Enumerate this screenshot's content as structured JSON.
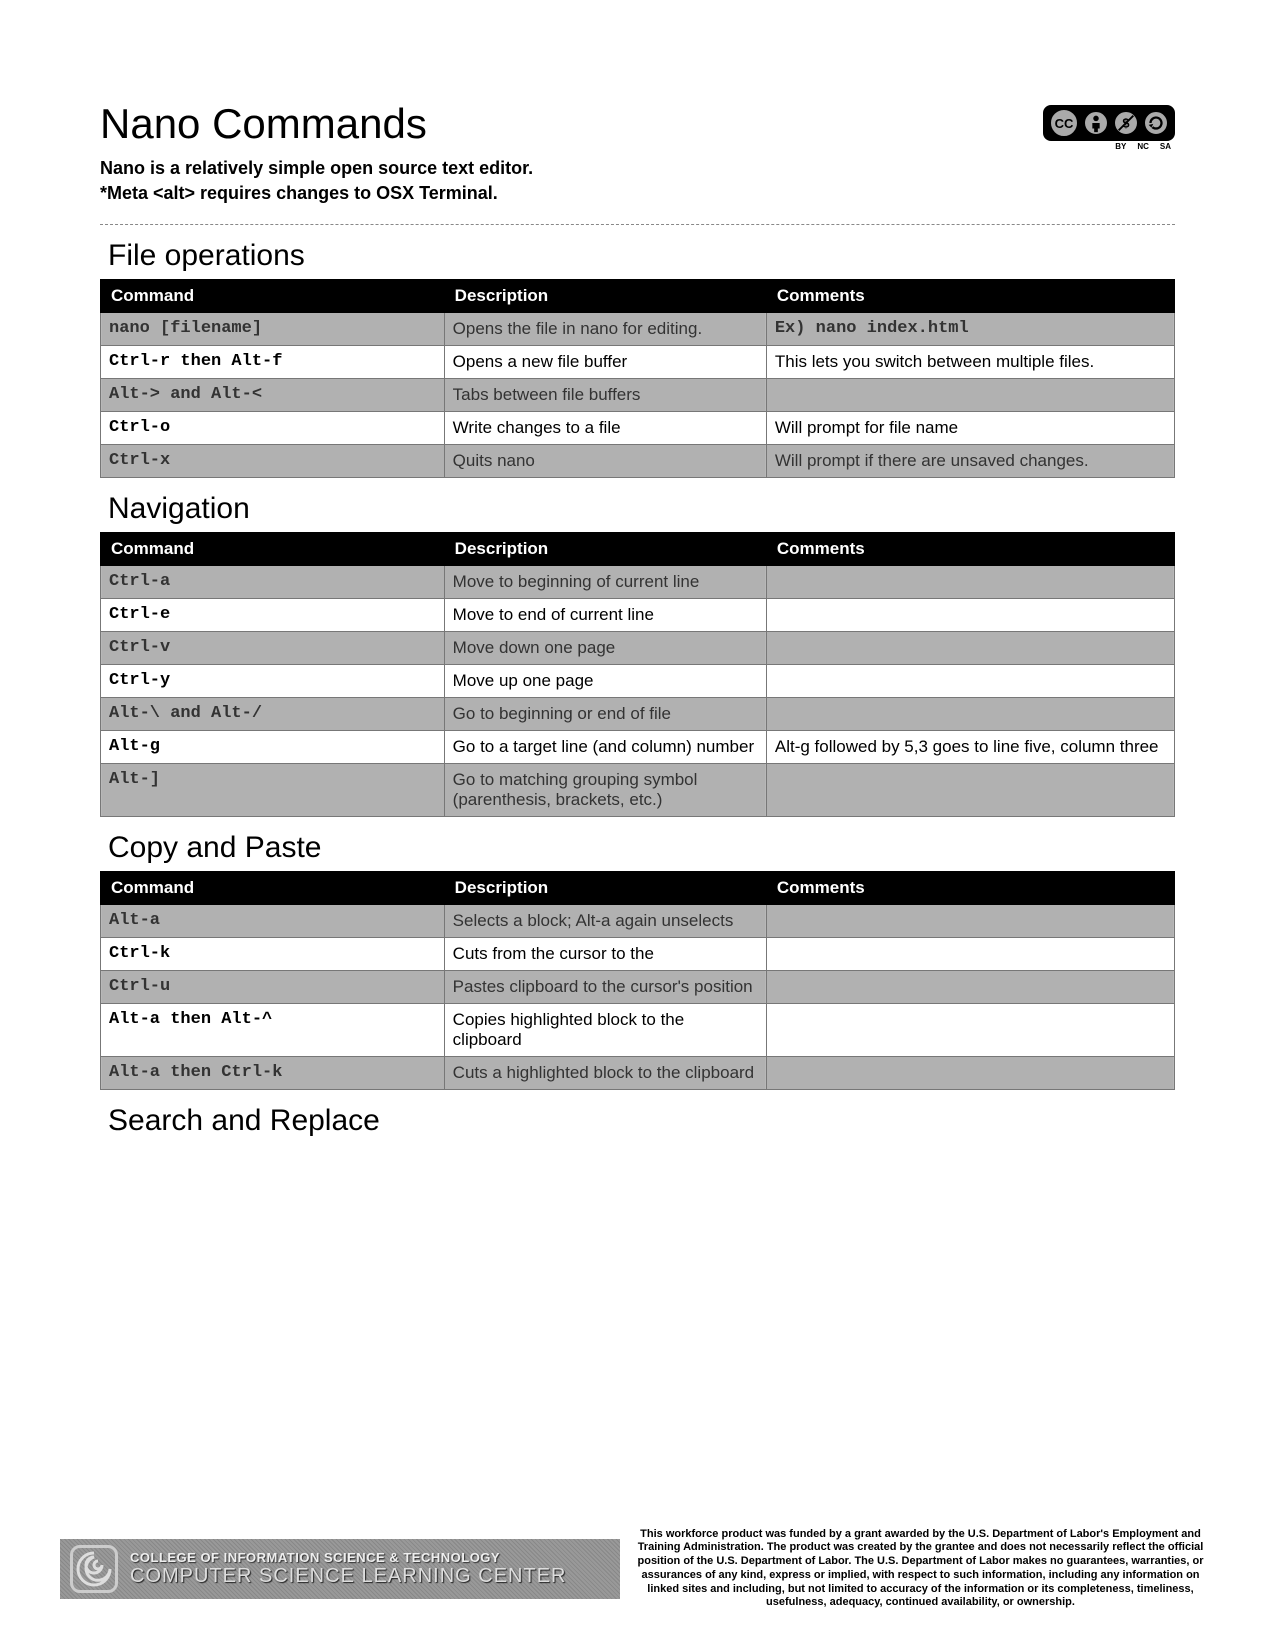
{
  "title": "Nano Commands",
  "subtitle_line1": "Nano is a relatively simple open source text editor.",
  "subtitle_line2": "*Meta <alt> requires changes to OSX Terminal.",
  "cc": {
    "labels": [
      "BY",
      "NC",
      "SA"
    ]
  },
  "headers": {
    "command": "Command",
    "description": "Description",
    "comments": "Comments"
  },
  "sections": [
    {
      "title": "File operations",
      "rows": [
        {
          "cmd": "nano [filename]",
          "desc": "Opens the file in nano for editing.",
          "comm": "Ex) nano index.html",
          "comm_mono": true
        },
        {
          "cmd": "Ctrl-r then Alt-f",
          "desc": "Opens a new file buffer",
          "comm": "This lets you switch between multiple files."
        },
        {
          "cmd": "Alt-> and Alt-<",
          "desc": "Tabs between file buffers",
          "comm": ""
        },
        {
          "cmd": "Ctrl-o",
          "desc": "Write changes to a file",
          "comm": "Will prompt for file name"
        },
        {
          "cmd": "Ctrl-x",
          "desc": "Quits nano",
          "comm": "Will prompt if there are unsaved changes."
        }
      ]
    },
    {
      "title": "Navigation",
      "rows": [
        {
          "cmd": "Ctrl-a",
          "desc": "Move to beginning of current line",
          "comm": ""
        },
        {
          "cmd": "Ctrl-e",
          "desc": "Move to end of current line",
          "comm": ""
        },
        {
          "cmd": "Ctrl-v",
          "desc": "Move down one page",
          "comm": ""
        },
        {
          "cmd": "Ctrl-y",
          "desc": "Move up one page",
          "comm": ""
        },
        {
          "cmd": "Alt-\\ and Alt-/",
          "desc": "Go to beginning  or end of file",
          "comm": ""
        },
        {
          "cmd": "Alt-g",
          "desc": "Go to a target line (and column) number",
          "comm": "Alt-g followed by 5,3 goes to line five, column three"
        },
        {
          "cmd": "Alt-]",
          "desc": "Go to matching grouping symbol (parenthesis, brackets, etc.)",
          "comm": ""
        }
      ]
    },
    {
      "title": "Copy and Paste",
      "rows": [
        {
          "cmd": "Alt-a",
          "desc": "Selects a block; Alt-a again unselects",
          "comm": ""
        },
        {
          "cmd": "Ctrl-k",
          "desc": "Cuts from the cursor to the",
          "comm": ""
        },
        {
          "cmd": "Ctrl-u",
          "desc": "Pastes clipboard to the cursor's position",
          "comm": ""
        },
        {
          "cmd": "Alt-a then Alt-^",
          "desc": "Copies highlighted block to the clipboard",
          "comm": ""
        },
        {
          "cmd": "Alt-a then Ctrl-k",
          "desc": "Cuts a highlighted block to the clipboard",
          "comm": ""
        }
      ]
    },
    {
      "title": "Search and Replace",
      "rows": []
    }
  ],
  "footer": {
    "org_line1": "COLLEGE OF INFORMATION SCIENCE & TECHNOLOGY",
    "org_line2": "COMPUTER SCIENCE LEARNING CENTER",
    "disclaimer": "This workforce product was funded by a grant awarded by the U.S. Department of Labor's Employment and Training Administration. The product was created by the grantee and does not necessarily reflect the official position of the U.S. Department of Labor. The U.S. Department of Labor makes no guarantees, warranties, or assurances of any kind, express or implied, with respect to such information, including any information on linked sites and including, but not limited to accuracy of the information or its completeness, timeliness, usefulness, adequacy, continued availability, or ownership."
  }
}
